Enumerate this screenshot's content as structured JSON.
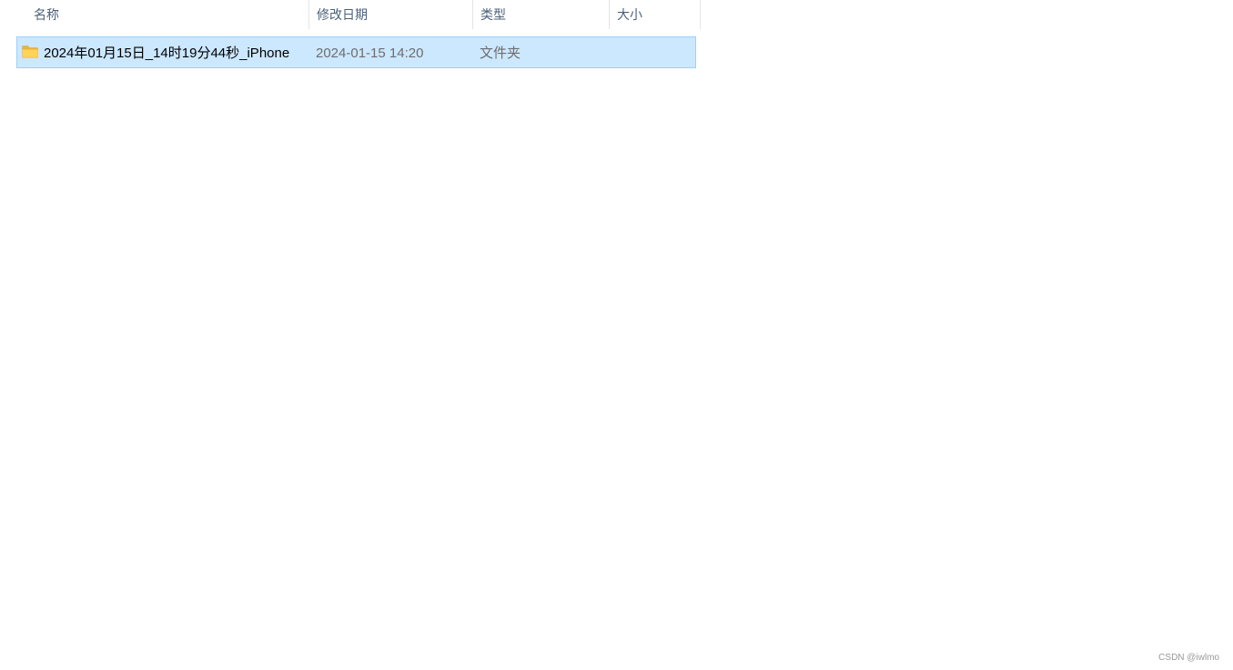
{
  "columns": {
    "name": "名称",
    "date_modified": "修改日期",
    "type": "类型",
    "size": "大小",
    "sort_indicator": "^"
  },
  "files": [
    {
      "name": "2024年01月15日_14时19分44秒_iPhone",
      "date_modified": "2024-01-15 14:20",
      "type": "文件夹",
      "size": "",
      "icon": "folder-icon",
      "selected": true
    }
  ],
  "watermark": "CSDN @iwlmo",
  "colors": {
    "selection_bg": "#cce8ff",
    "selection_border": "#99d1ff",
    "header_text": "#4c607a",
    "secondary_text": "#6d6d6d",
    "folder_yellow": "#ffd25a"
  }
}
